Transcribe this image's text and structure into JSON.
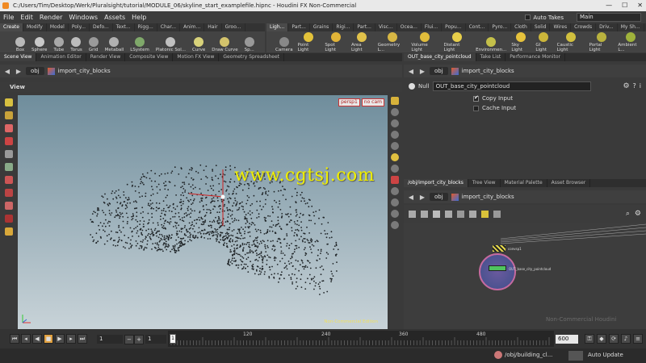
{
  "window": {
    "title": "C:/Users/Tim/Desktop/Werk/Pluralsight/tutorial/MODULE_06/skyline_start_examplefile.hipnc - Houdini FX Non-Commercial",
    "controls": [
      "—",
      "☐",
      "✕"
    ]
  },
  "menubar": {
    "items": [
      "File",
      "Edit",
      "Render",
      "Windows",
      "Assets",
      "Help"
    ],
    "auto_takes_label": "Auto Takes",
    "desktop_value": "Main"
  },
  "shelf_tabs_left": [
    "Create",
    "Modify",
    "Model",
    "Poly...",
    "Defo...",
    "Text...",
    "Rigg...",
    "Char...",
    "Anim...",
    "Hair",
    "Groo..."
  ],
  "shelf_tabs_right": [
    "Ligh...",
    "Part...",
    "Grains",
    "Rigi...",
    "Part...",
    "Visc...",
    "Ocea...",
    "Flui...",
    "Popu...",
    "Cont...",
    "Pyro...",
    "Cloth",
    "Solid",
    "Wires",
    "Crowds",
    "Driv...",
    "My Sh..."
  ],
  "tools_left": [
    {
      "label": "Box",
      "color": "#b9b9b9"
    },
    {
      "label": "Sphere",
      "color": "#c8c8c8"
    },
    {
      "label": "Tube",
      "color": "#a8a8a8"
    },
    {
      "label": "Torus",
      "color": "#bcbcbc"
    },
    {
      "label": "Grid",
      "color": "#9a9a9a"
    },
    {
      "label": "Metaball",
      "color": "#b0b0b0"
    },
    {
      "label": "LSystem",
      "color": "#7fa86a"
    },
    {
      "label": "Platonic Sol...",
      "color": "#c0c0c0"
    },
    {
      "label": "Curve",
      "color": "#d8d27a"
    },
    {
      "label": "Draw Curve",
      "color": "#d3c36c"
    },
    {
      "label": "Sp...",
      "color": "#999999"
    }
  ],
  "tools_right": [
    {
      "label": "Camera",
      "color": "#888888"
    },
    {
      "label": "Point Light",
      "color": "#e3c23a"
    },
    {
      "label": "Spot Light",
      "color": "#e2b437"
    },
    {
      "label": "Area Light",
      "color": "#e1c24a"
    },
    {
      "label": "Geometry L...",
      "color": "#d7b744"
    },
    {
      "label": "Volume Light",
      "color": "#e0bc3b"
    },
    {
      "label": "Distant Light",
      "color": "#e8cf4a"
    },
    {
      "label": "Environmen...",
      "color": "#c4c04a"
    },
    {
      "label": "Sky Light",
      "color": "#e6c23c"
    },
    {
      "label": "GI Light",
      "color": "#ccb63a"
    },
    {
      "label": "Caustic Light",
      "color": "#d1c03e"
    },
    {
      "label": "Portal Light",
      "color": "#b9b23e"
    },
    {
      "label": "Ambient L...",
      "color": "#9fb23b"
    }
  ],
  "left_pane": {
    "tabs": [
      "Scene View",
      "Animation Editor",
      "Render View",
      "Composite View",
      "Motion FX View",
      "Geometry Spreadsheet"
    ],
    "path_root": "obj",
    "path_node": "import_city_blocks",
    "view_label": "View",
    "camera_menu": "persp1",
    "cam_menu": "no cam",
    "watermark": "www.cgtsj.com",
    "non_commercial": "Non-Commercial Edition"
  },
  "param_pane": {
    "tabs": [
      "OUT_base_city_pointcloud",
      "Take List",
      "Performance Monitor"
    ],
    "path_root": "obj",
    "path_node": "import_city_blocks",
    "node_type": "Null",
    "node_name": "OUT_base_city_pointcloud",
    "copy_input_label": "Copy Input",
    "cache_input_label": "Cache Input"
  },
  "network_pane": {
    "tabs": [
      "/obj/import_city_blocks",
      "Tree View",
      "Material Palette",
      "Asset Browser"
    ],
    "path_root": "obj",
    "path_node": "import_city_blocks",
    "node_labels": [
      "convsp1",
      "OUT_base_city_pointcloud"
    ],
    "faint_text": "Non-Commercial Houdini"
  },
  "timeline": {
    "start_frame": "1",
    "current_frame": "1",
    "ticks": [
      "1",
      "120",
      "240",
      "360",
      "480",
      "600"
    ],
    "end_frame": "600"
  },
  "statusbar": {
    "path": "/obj/building_cl...",
    "auto_update": "Auto Update"
  }
}
